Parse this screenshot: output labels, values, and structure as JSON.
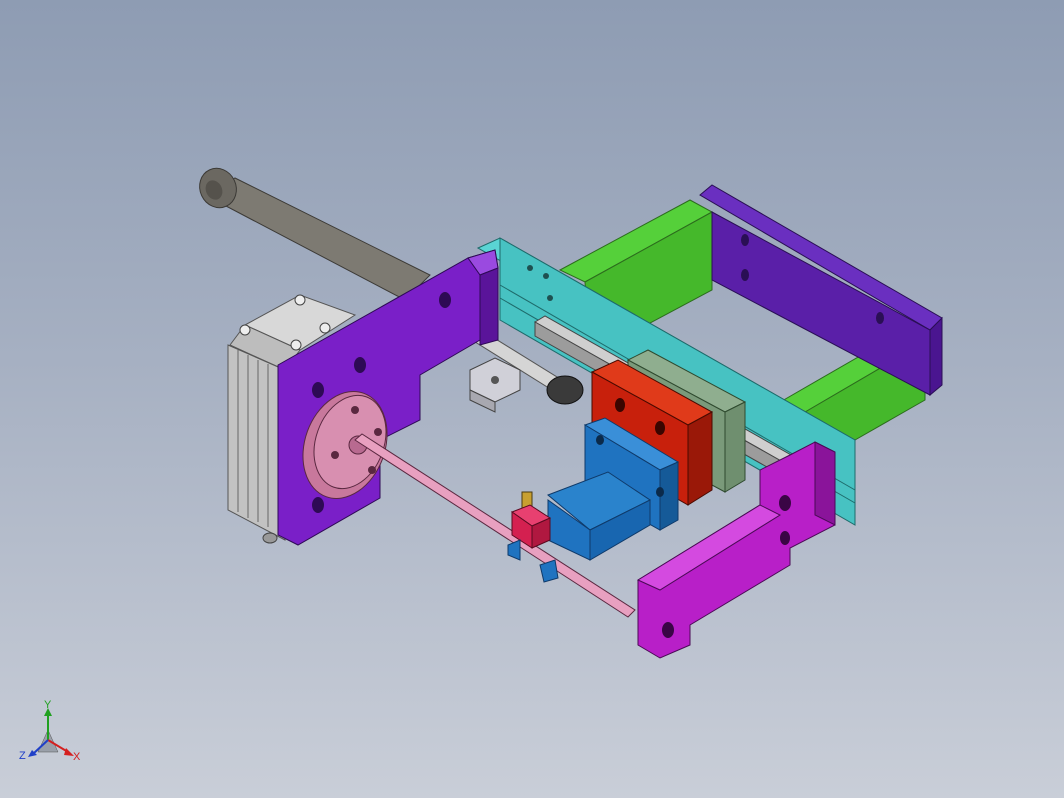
{
  "viewport": {
    "background_top": "#8e9cb3",
    "background_bottom": "#c9ced8"
  },
  "model": {
    "part_colors": {
      "base_plate_purple": "#7a1fc8",
      "right_bracket_indigo": "#5a1fa8",
      "green_rails": "#45b82b",
      "cyan_beam": "#47c2c2",
      "red_block": "#c8200c",
      "sage_carriage": "#6f8f6f",
      "blue_slider": "#1f73c0",
      "magenta_arm": "#b81fc8",
      "pink_flange": "#d88fb0",
      "cylinder_gray": "#7d7a72",
      "block_gray": "#c8c8c8",
      "sensor_red": "#d42050"
    }
  },
  "triad": {
    "x_label": "X",
    "y_label": "Y",
    "z_label": "Z",
    "x_color": "#d42020",
    "y_color": "#20a020",
    "z_color": "#2040c8"
  }
}
